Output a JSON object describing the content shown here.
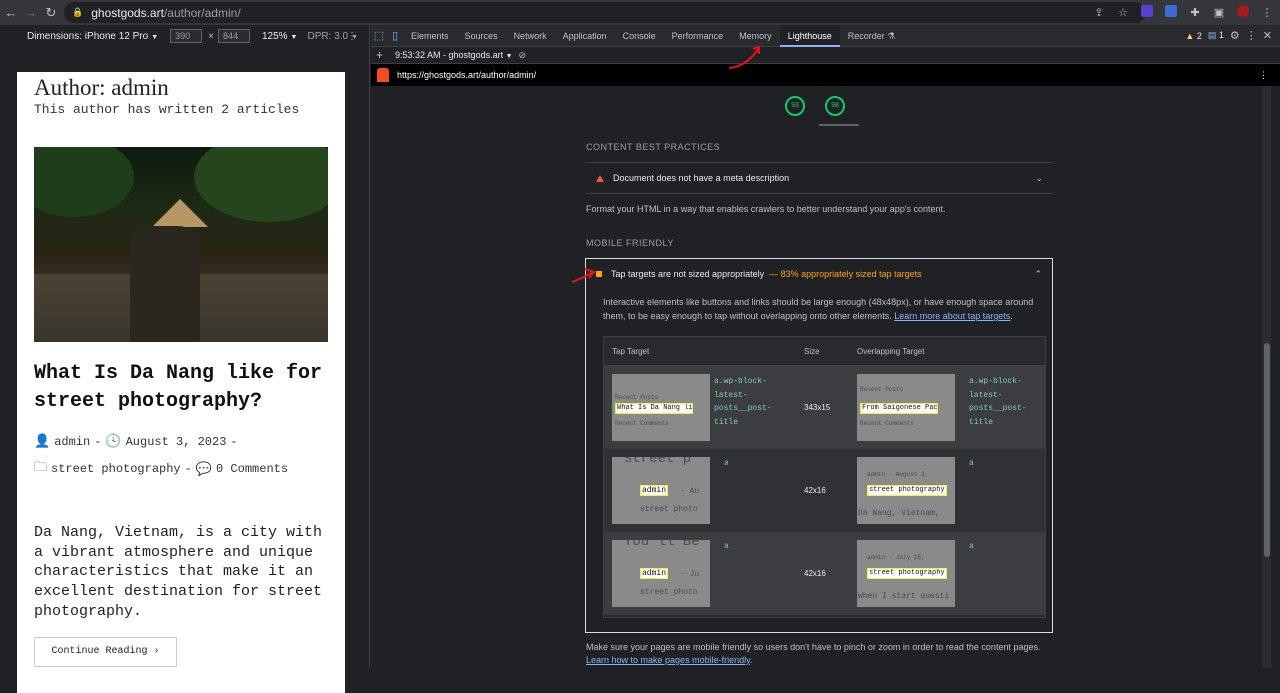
{
  "browser": {
    "url_host": "ghostgods.art",
    "url_path": "/author/admin/"
  },
  "device_toolbar": {
    "dimensions_label": "Dimensions: iPhone 12 Pro",
    "width": "390",
    "height": "844",
    "zoom": "125%",
    "dpr": "DPR: 3.0"
  },
  "page": {
    "author_title": "Author: admin",
    "article_count": "This author has written 2 articles",
    "post_title": "What Is Da Nang like for street photography?",
    "meta_author": "admin",
    "meta_date": "August 3, 2023",
    "meta_category": "street photography",
    "meta_comments": "0 Comments",
    "excerpt": "Da Nang, Vietnam, is a city with a vibrant atmosphere and unique characteristics that make it an excellent destination for street photography.",
    "continue_label": "Continue Reading"
  },
  "devtools": {
    "tabs": [
      "Elements",
      "Sources",
      "Network",
      "Application",
      "Console",
      "Performance",
      "Memory",
      "Lighthouse",
      "Recorder"
    ],
    "active_tab": "Lighthouse",
    "warning_count": "2",
    "info_count": "1",
    "report_selector": "9:53:32 AM - ghostgods.art",
    "report_url": "https://ghostgods.art/author/admin/"
  },
  "lighthouse": {
    "scores": [
      "93",
      "98"
    ],
    "content_section": "CONTENT BEST PRACTICES",
    "meta_audit": "Document does not have a meta description",
    "content_desc": "Format your HTML in a way that enables crawlers to better understand your app's content.",
    "mobile_section": "MOBILE FRIENDLY",
    "tap_audit": "Tap targets are not sized appropriately",
    "tap_display": "— 83% appropriately sized tap targets",
    "tap_desc": "Interactive elements like buttons and links should be large enough (48x48px), or have enough space around them, to be easy enough to tap without overlapping onto other elements.",
    "tap_learn_more": "Learn more about tap targets",
    "table_headers": [
      "Tap Target",
      "Size",
      "Overlapping Target"
    ],
    "rows": [
      {
        "target": "a.wp-block-latest-posts__post-title",
        "size": "343x15",
        "overlap": "a.wp-block-latest-posts__post-title"
      },
      {
        "target": "a",
        "size": "42x16",
        "overlap": "a"
      },
      {
        "target": "a",
        "size": "42x16",
        "overlap": "a"
      }
    ],
    "footer_text": "Make sure your pages are mobile friendly so users don't have to pinch or zoom in order to read the content pages.",
    "footer_link": "Learn how to make pages mobile-friendly"
  },
  "thumbs": {
    "r1_left_top": "Recent Posts",
    "r1_left_hl": "What Is Da Nang like for street photography?",
    "r1_left_bot": "Recent Comments",
    "r1_right_top": "Recent Posts",
    "r1_right_hl": "From Saigonese Pace Meet Hanoi Nosh",
    "r1_right_bot": "Recent Comments",
    "r2_left_big": "street p",
    "r2_left_hl": "admin",
    "r2_left_date": "- Au",
    "r2_left_cat": "street photo",
    "r2_right_meta": "admin - August 3,",
    "r2_right_hl": "street photography",
    "r2_right_bot": "Da Nang, Vietnam,",
    "r3_left_big": "You'll Be",
    "r3_left_hl": "admin",
    "r3_left_date": "- Ju",
    "r3_left_cat": "street photo",
    "r3_right_meta": "admin - July 16,",
    "r3_right_hl": "street photography",
    "r3_right_bot": "When I start questi"
  }
}
